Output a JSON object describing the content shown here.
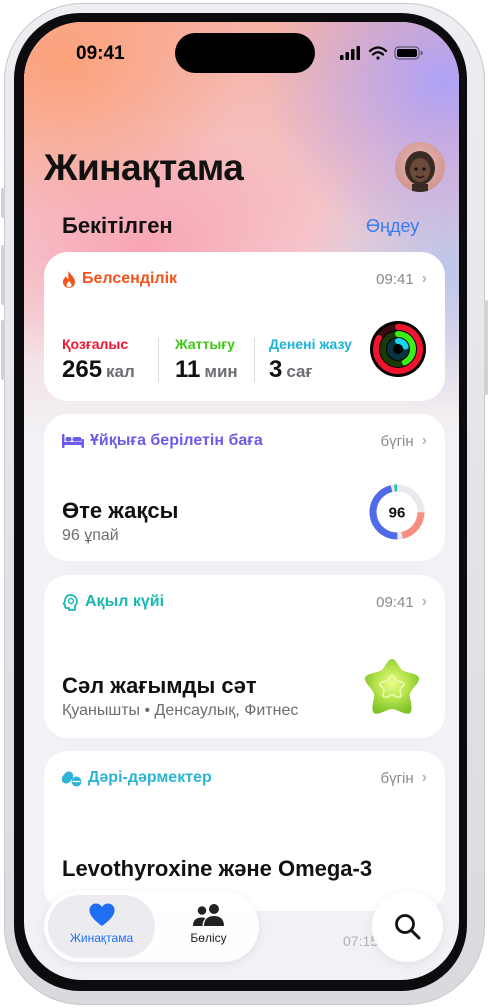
{
  "status_bar": {
    "time": "09:41"
  },
  "header": {
    "title": "Жинақтама"
  },
  "pinned": {
    "title": "Бекітілген",
    "edit_label": "Өңдеу"
  },
  "cards": {
    "activity": {
      "title": "Белсенділік",
      "time": "09:41",
      "accent": "#f2541b",
      "metrics": [
        {
          "label": "Қозғалыс",
          "value": "265",
          "unit": "кал",
          "color": "#f0142f"
        },
        {
          "label": "Жаттығу",
          "value": "11",
          "unit": "мин",
          "color": "#3cc914"
        },
        {
          "label": "Денені жазу",
          "value": "3",
          "unit": "сағ",
          "color": "#1bb4d8"
        }
      ]
    },
    "sleep": {
      "title": "Ұйқыға берілетін баға",
      "time": "бүгін",
      "accent": "#6b5ce7",
      "rating": "Өте жақсы",
      "points": "96 ұпай",
      "score": "96"
    },
    "mind": {
      "title": "Ақыл күйі",
      "time": "09:41",
      "accent": "#17b8b0",
      "state": "Сәл жағымды сәт",
      "details": "Қуанышты • Денсаулық, Фитнес"
    },
    "meds": {
      "title": "Дәрі-дәрмектер",
      "time": "бүгін",
      "accent": "#2cb4d4",
      "names": "Levothyroxine және Omega-3"
    }
  },
  "ghost_time": "07:15",
  "tabbar": {
    "summary_label": "Жинақтама",
    "sharing_label": "Бөлісу",
    "active_color": "#1f6ff2"
  }
}
